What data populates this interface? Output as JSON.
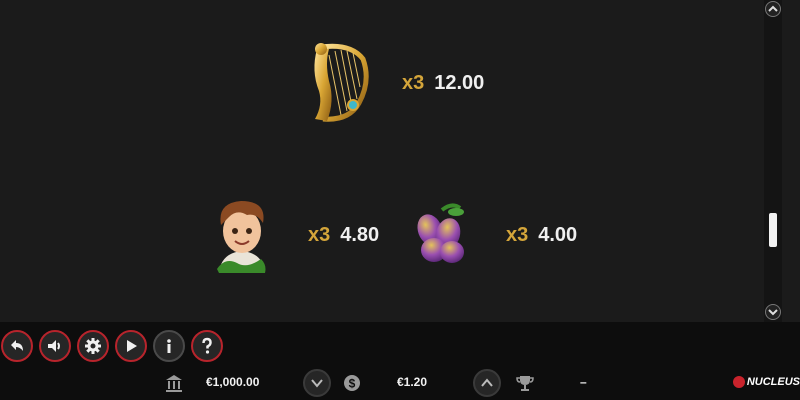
{
  "paytable": {
    "entries": [
      {
        "symbol": "golden-harp",
        "multiplier": "x3",
        "payout": "12.00"
      },
      {
        "symbol": "boy-face",
        "multiplier": "x3",
        "payout": "4.80"
      },
      {
        "symbol": "magic-beans",
        "multiplier": "x3",
        "payout": "4.00"
      }
    ]
  },
  "scrollbar": {
    "position": 0.78
  },
  "controls": {
    "buttons": [
      {
        "name": "back-button",
        "icon": "back-arrow-icon"
      },
      {
        "name": "sound-button",
        "icon": "speaker-icon"
      },
      {
        "name": "settings-button",
        "icon": "gear-icon"
      },
      {
        "name": "autoplay-button",
        "icon": "play-icon"
      },
      {
        "name": "info-button",
        "icon": "info-icon"
      },
      {
        "name": "help-button",
        "icon": "question-icon"
      }
    ]
  },
  "bottom_bar": {
    "balance": "€1,000.00",
    "bet": "€1.20",
    "win": "–",
    "brand": "NUCLEUS"
  },
  "colors": {
    "accent": "#b8242c",
    "gold": "#d4a53a",
    "background": "#1b1b1b",
    "toolbar": "#0d0d0d"
  }
}
